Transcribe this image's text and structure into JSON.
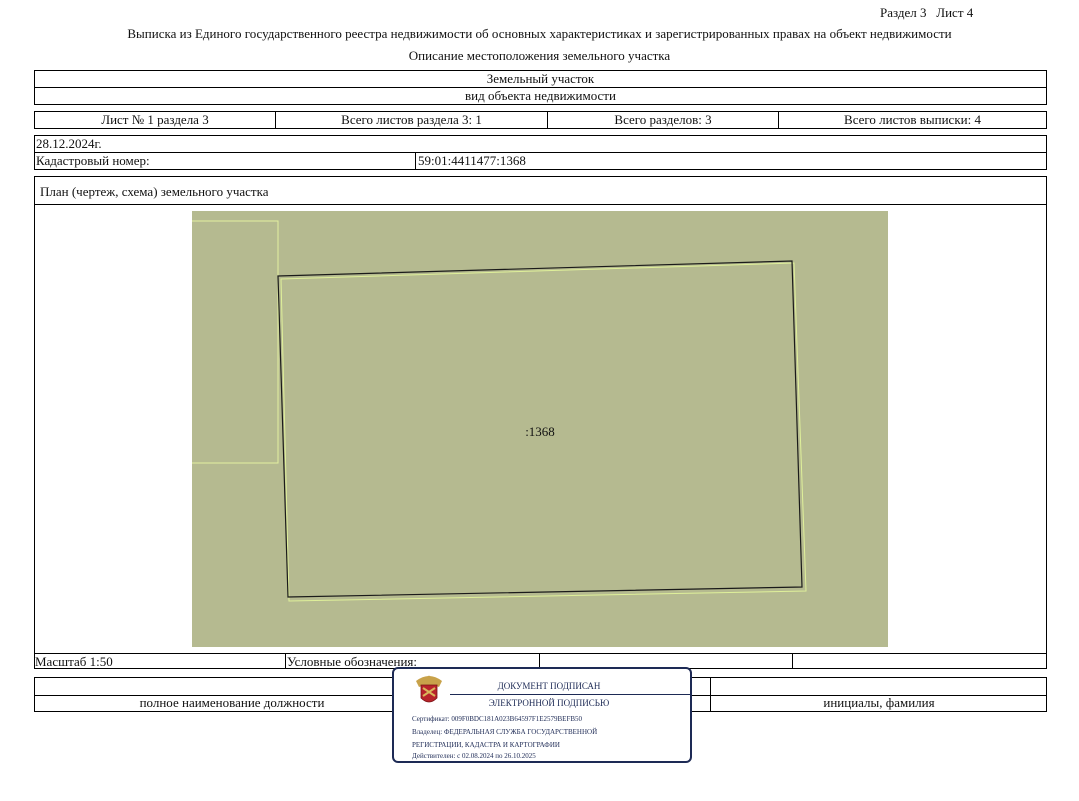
{
  "header": {
    "section_sheet": "Раздел 3   Лист 4",
    "title": "Выписка из Единого государственного реестра недвижимости об основных характеристиках и зарегистрированных правах на объект недвижимости",
    "subtitle": "Описание местоположения земельного участка"
  },
  "object": {
    "type": "Земельный участок",
    "type_caption": "вид объекта недвижимости"
  },
  "sheets": {
    "sheet_no": "Лист № 1 раздела 3",
    "sheets_in_section": "Всего листов раздела 3: 1",
    "sections_total": "Всего разделов: 3",
    "sheets_total": "Всего листов выписки: 4"
  },
  "info": {
    "date": "28.12.2024г.",
    "cadastral_label": "Кадастровый номер:",
    "cadastral_number": "59:01:4411477:1368"
  },
  "plan": {
    "title": "План (чертеж, схема) земельного участка",
    "parcel_label": ":1368",
    "colors": {
      "background": "#b5ba90",
      "outline": "#1a1a1a",
      "neighbor": "#e3f0a0"
    }
  },
  "footer": {
    "scale": "Масштаб 1:50",
    "legend_label": "Условные обозначения:",
    "position_caption": "полное наименование должности",
    "initials_caption": "инициалы, фамилия"
  },
  "stamp": {
    "line1": "ДОКУМЕНТ ПОДПИСАН",
    "line2": "ЭЛЕКТРОННОЙ ПОДПИСЬЮ",
    "certificate": "Сертификат: 009F0BDC181A023B64597F1E2579BEFB50",
    "owner1": "Владелец: ФЕДЕРАЛЬНАЯ СЛУЖБА ГОСУДАРСТВЕННОЙ",
    "owner2": "РЕГИСТРАЦИИ, КАДАСТРА И КАРТОГРАФИИ",
    "validity": "Действителен: с 02.08.2024 по 26.10.2025"
  }
}
